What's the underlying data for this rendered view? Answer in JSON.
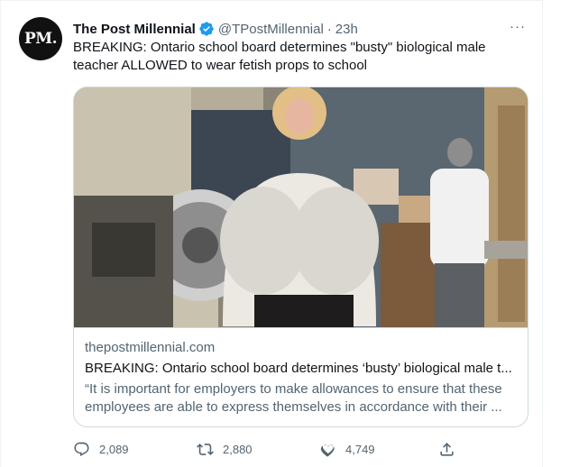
{
  "tweet": {
    "avatar_text": "PM.",
    "display_name": "The Post Millennial",
    "handle": "@TPostMillennial",
    "separator": "·",
    "time": "23h",
    "more": "···",
    "text_line1": "BREAKING: Ontario school board determines \"busty\" biological male",
    "text_line2": "teacher ALLOWED to wear fetish props to school"
  },
  "card": {
    "domain": "thepostmillennial.com",
    "title": "BREAKING: Ontario school board determines ‘busty’ biological male t...",
    "desc_line1": "“It is important for employers to make allowances to ensure that these",
    "desc_line2": "employees are able to express themselves in accordance with their ..."
  },
  "actions": {
    "reply_count": "2,089",
    "retweet_count": "2,880",
    "like_count": "4,749"
  },
  "colors": {
    "verified_blue": "#1d9bf0",
    "secondary_text": "#536471",
    "border": "#cfd9de"
  },
  "icons": [
    "verified-badge-icon",
    "more-icon",
    "reply-icon",
    "retweet-icon",
    "like-icon",
    "share-icon"
  ]
}
